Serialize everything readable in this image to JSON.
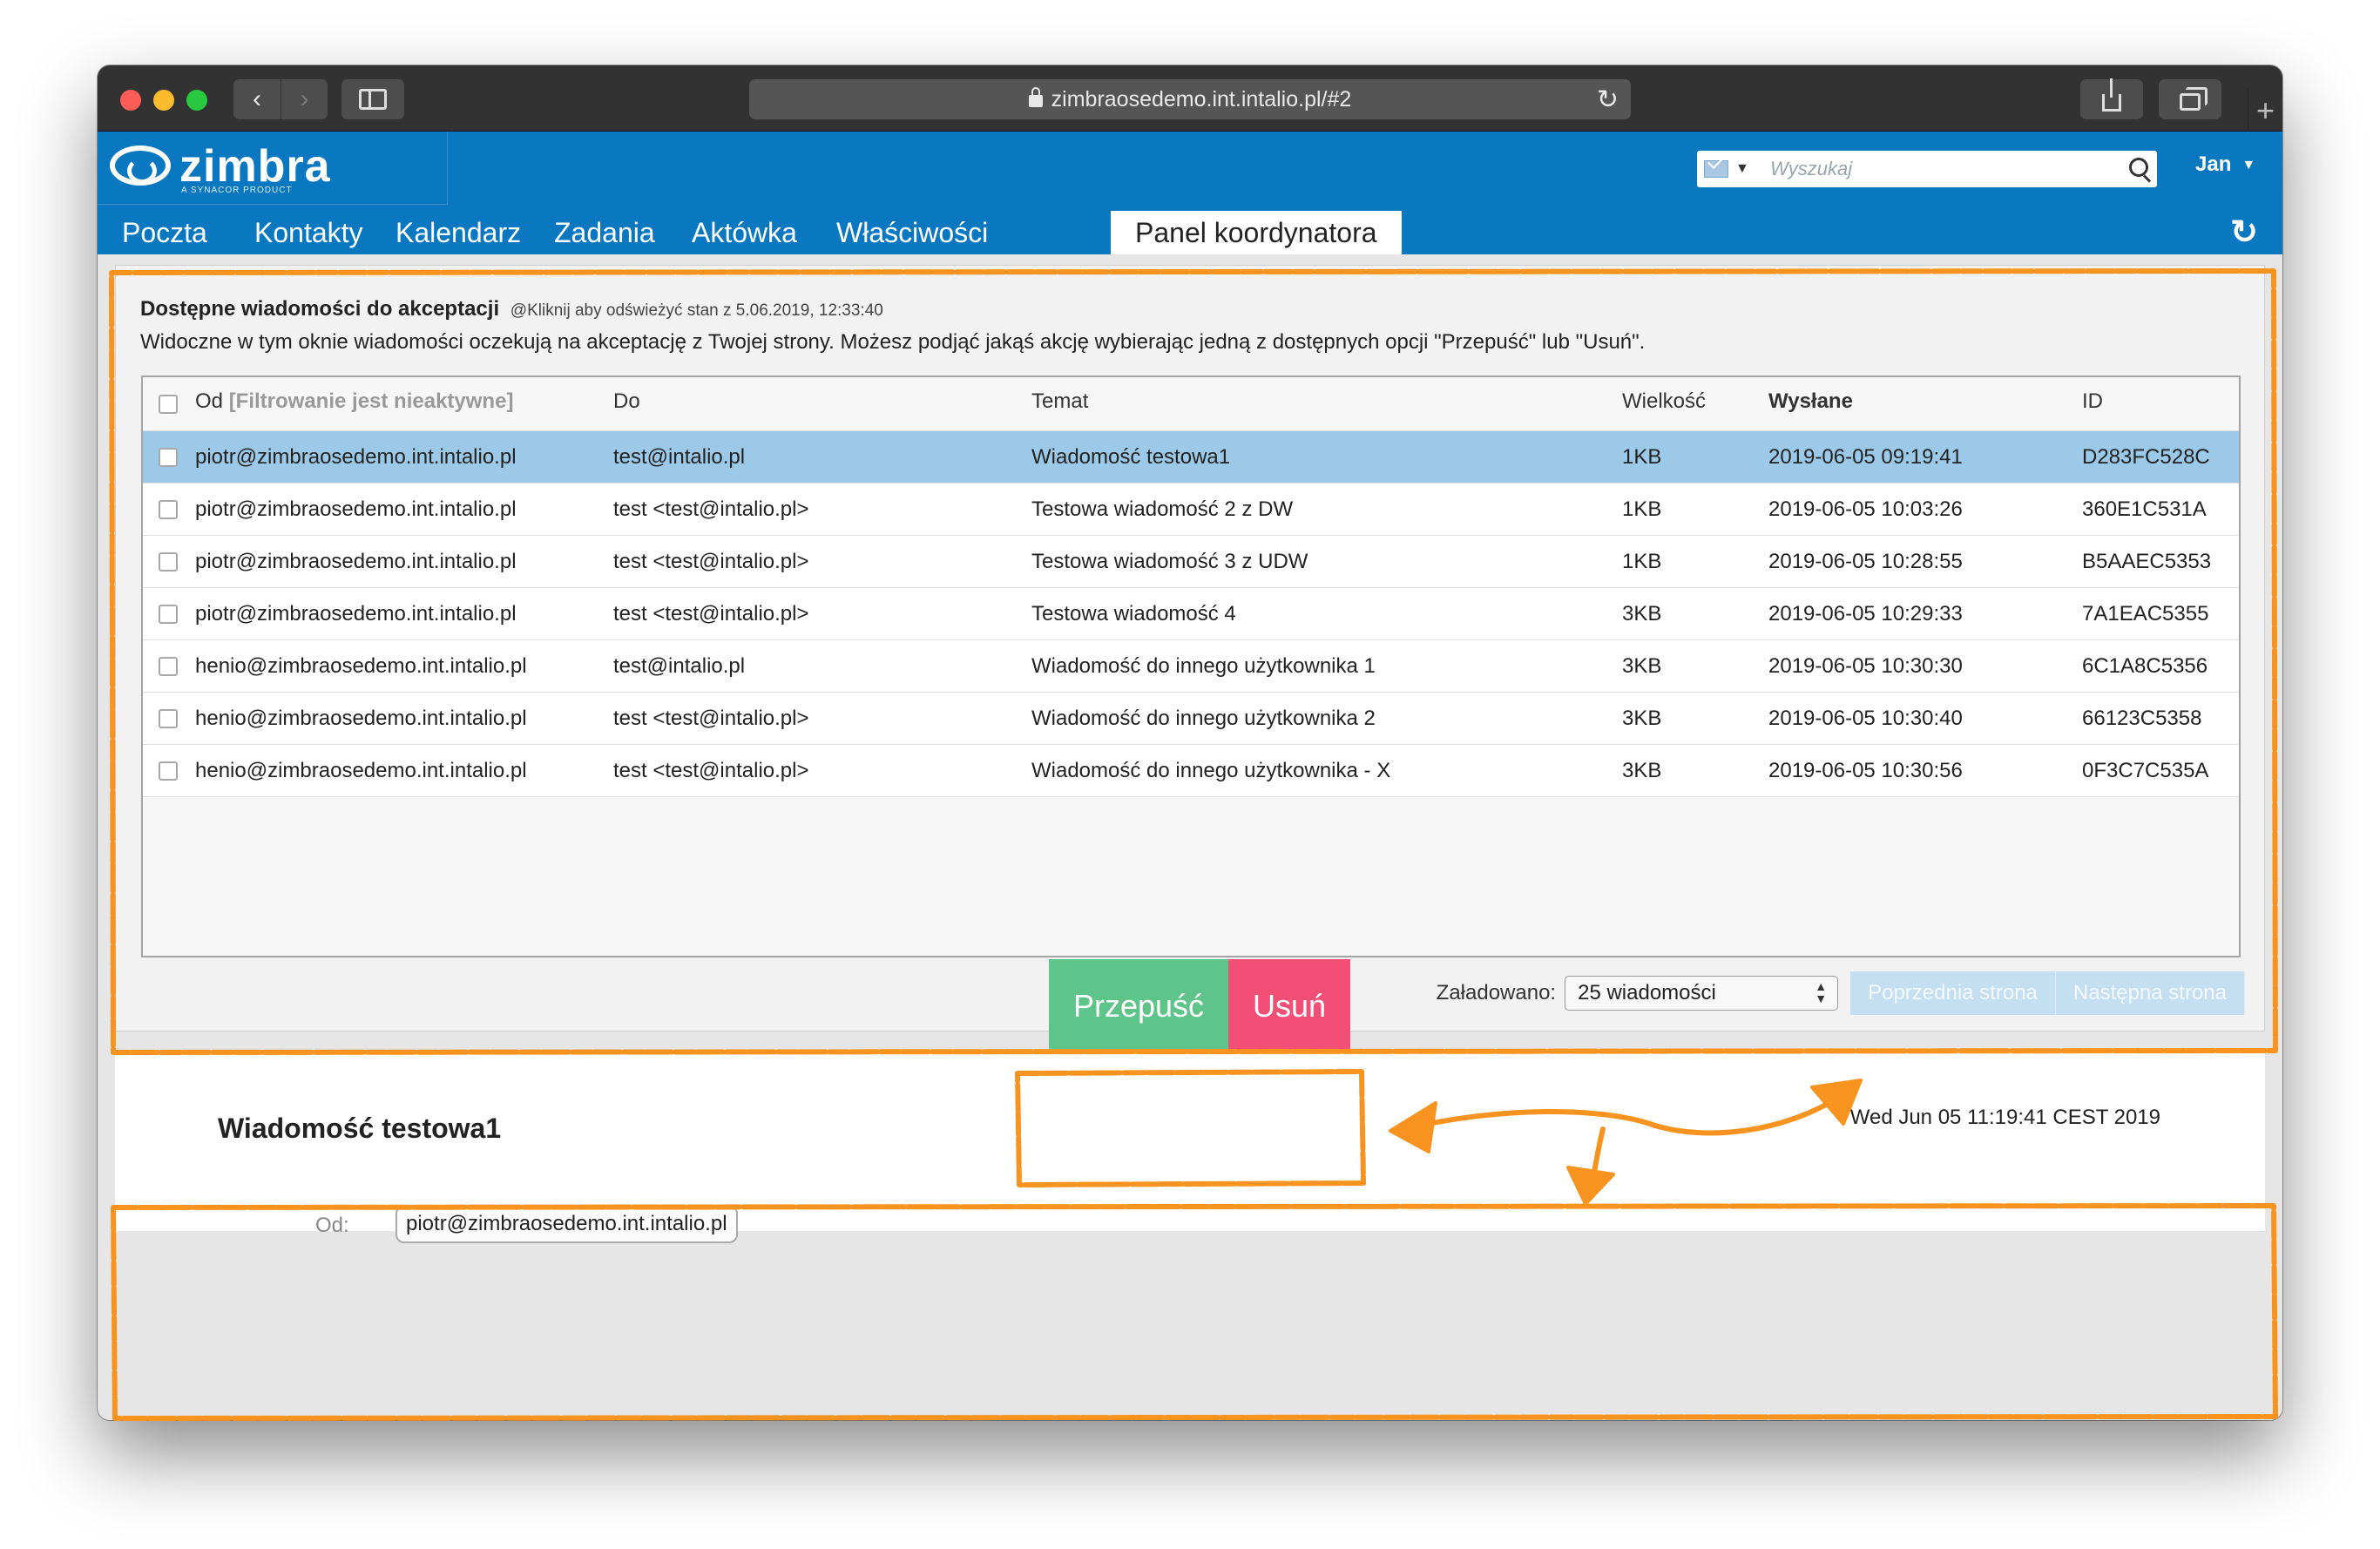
{
  "browser": {
    "url": "zimbraosedemo.int.intalio.pl/#2",
    "back_label": "‹",
    "forward_label": "›",
    "new_tab_label": "+"
  },
  "header": {
    "logo_text": "zimbra",
    "logo_subtitle": "A SYNACOR PRODUCT",
    "search_placeholder": "Wyszukaj",
    "user_name": "Jan",
    "tabs": [
      {
        "label": "Poczta"
      },
      {
        "label": "Kontakty"
      },
      {
        "label": "Kalendarz"
      },
      {
        "label": "Zadania"
      },
      {
        "label": "Aktówka"
      },
      {
        "label": "Właściwości"
      },
      {
        "label": "Panel koordynatora"
      }
    ]
  },
  "panel": {
    "title": "Dostępne wiadomości do akceptacji",
    "refresh_text": "@Kliknij aby odświeżyć stan z 5.06.2019, 12:33:40",
    "description": "Widoczne w tym oknie wiadomości oczekują na akceptację z Twojej strony. Możesz podjąć jakąś akcję wybierając jedną z dostępnych opcji \"Przepuść\" lub \"Usuń\"."
  },
  "table": {
    "columns": {
      "from": "Od",
      "from_filter": "[Filtrowanie jest nieaktywne]",
      "to": "Do",
      "subject": "Temat",
      "size": "Wielkość",
      "sent": "Wysłane",
      "id": "ID"
    },
    "rows": [
      {
        "from": "piotr@zimbraosedemo.int.intalio.pl",
        "to": "test@intalio.pl",
        "subject": "Wiadomość testowa1",
        "size": "1KB",
        "sent": "2019-06-05 09:19:41",
        "id": "D283FC528C"
      },
      {
        "from": "piotr@zimbraosedemo.int.intalio.pl",
        "to": "test <test@intalio.pl>",
        "subject": "Testowa wiadomość 2 z DW",
        "size": "1KB",
        "sent": "2019-06-05 10:03:26",
        "id": "360E1C531A"
      },
      {
        "from": "piotr@zimbraosedemo.int.intalio.pl",
        "to": "test <test@intalio.pl>",
        "subject": "Testowa wiadomość 3 z UDW",
        "size": "1KB",
        "sent": "2019-06-05 10:28:55",
        "id": "B5AAEC5353"
      },
      {
        "from": "piotr@zimbraosedemo.int.intalio.pl",
        "to": "test <test@intalio.pl>",
        "subject": "Testowa wiadomość 4",
        "size": "3KB",
        "sent": "2019-06-05 10:29:33",
        "id": "7A1EAC5355"
      },
      {
        "from": "henio@zimbraosedemo.int.intalio.pl",
        "to": "test@intalio.pl",
        "subject": "Wiadomość do innego użytkownika 1",
        "size": "3KB",
        "sent": "2019-06-05 10:30:30",
        "id": "6C1A8C5356"
      },
      {
        "from": "henio@zimbraosedemo.int.intalio.pl",
        "to": "test <test@intalio.pl>",
        "subject": "Wiadomość do innego użytkownika 2",
        "size": "3KB",
        "sent": "2019-06-05 10:30:40",
        "id": "66123C5358"
      },
      {
        "from": "henio@zimbraosedemo.int.intalio.pl",
        "to": "test <test@intalio.pl>",
        "subject": "Wiadomość do innego użytkownika - X",
        "size": "3KB",
        "sent": "2019-06-05 10:30:56",
        "id": "0F3C7C535A"
      }
    ],
    "selected_row": 0
  },
  "pager": {
    "loaded_label": "Załadowano:",
    "page_size": "25 wiadomości",
    "prev_label": "Poprzednia strona",
    "next_label": "Następna strona"
  },
  "actions": {
    "accept_label": "Przepuść",
    "delete_label": "Usuń"
  },
  "preview": {
    "subject": "Wiadomość testowa1",
    "date": "Wed Jun 05 11:19:41 CEST 2019",
    "from_label": "Od:",
    "from_value": "piotr@zimbraosedemo.int.intalio.pl"
  },
  "colors": {
    "brand_blue": "#0a78c1",
    "selected_row": "#9cc9e8",
    "accept_green": "#5ec48a",
    "delete_pink": "#f24f77",
    "annotation_orange": "#f7931e"
  }
}
